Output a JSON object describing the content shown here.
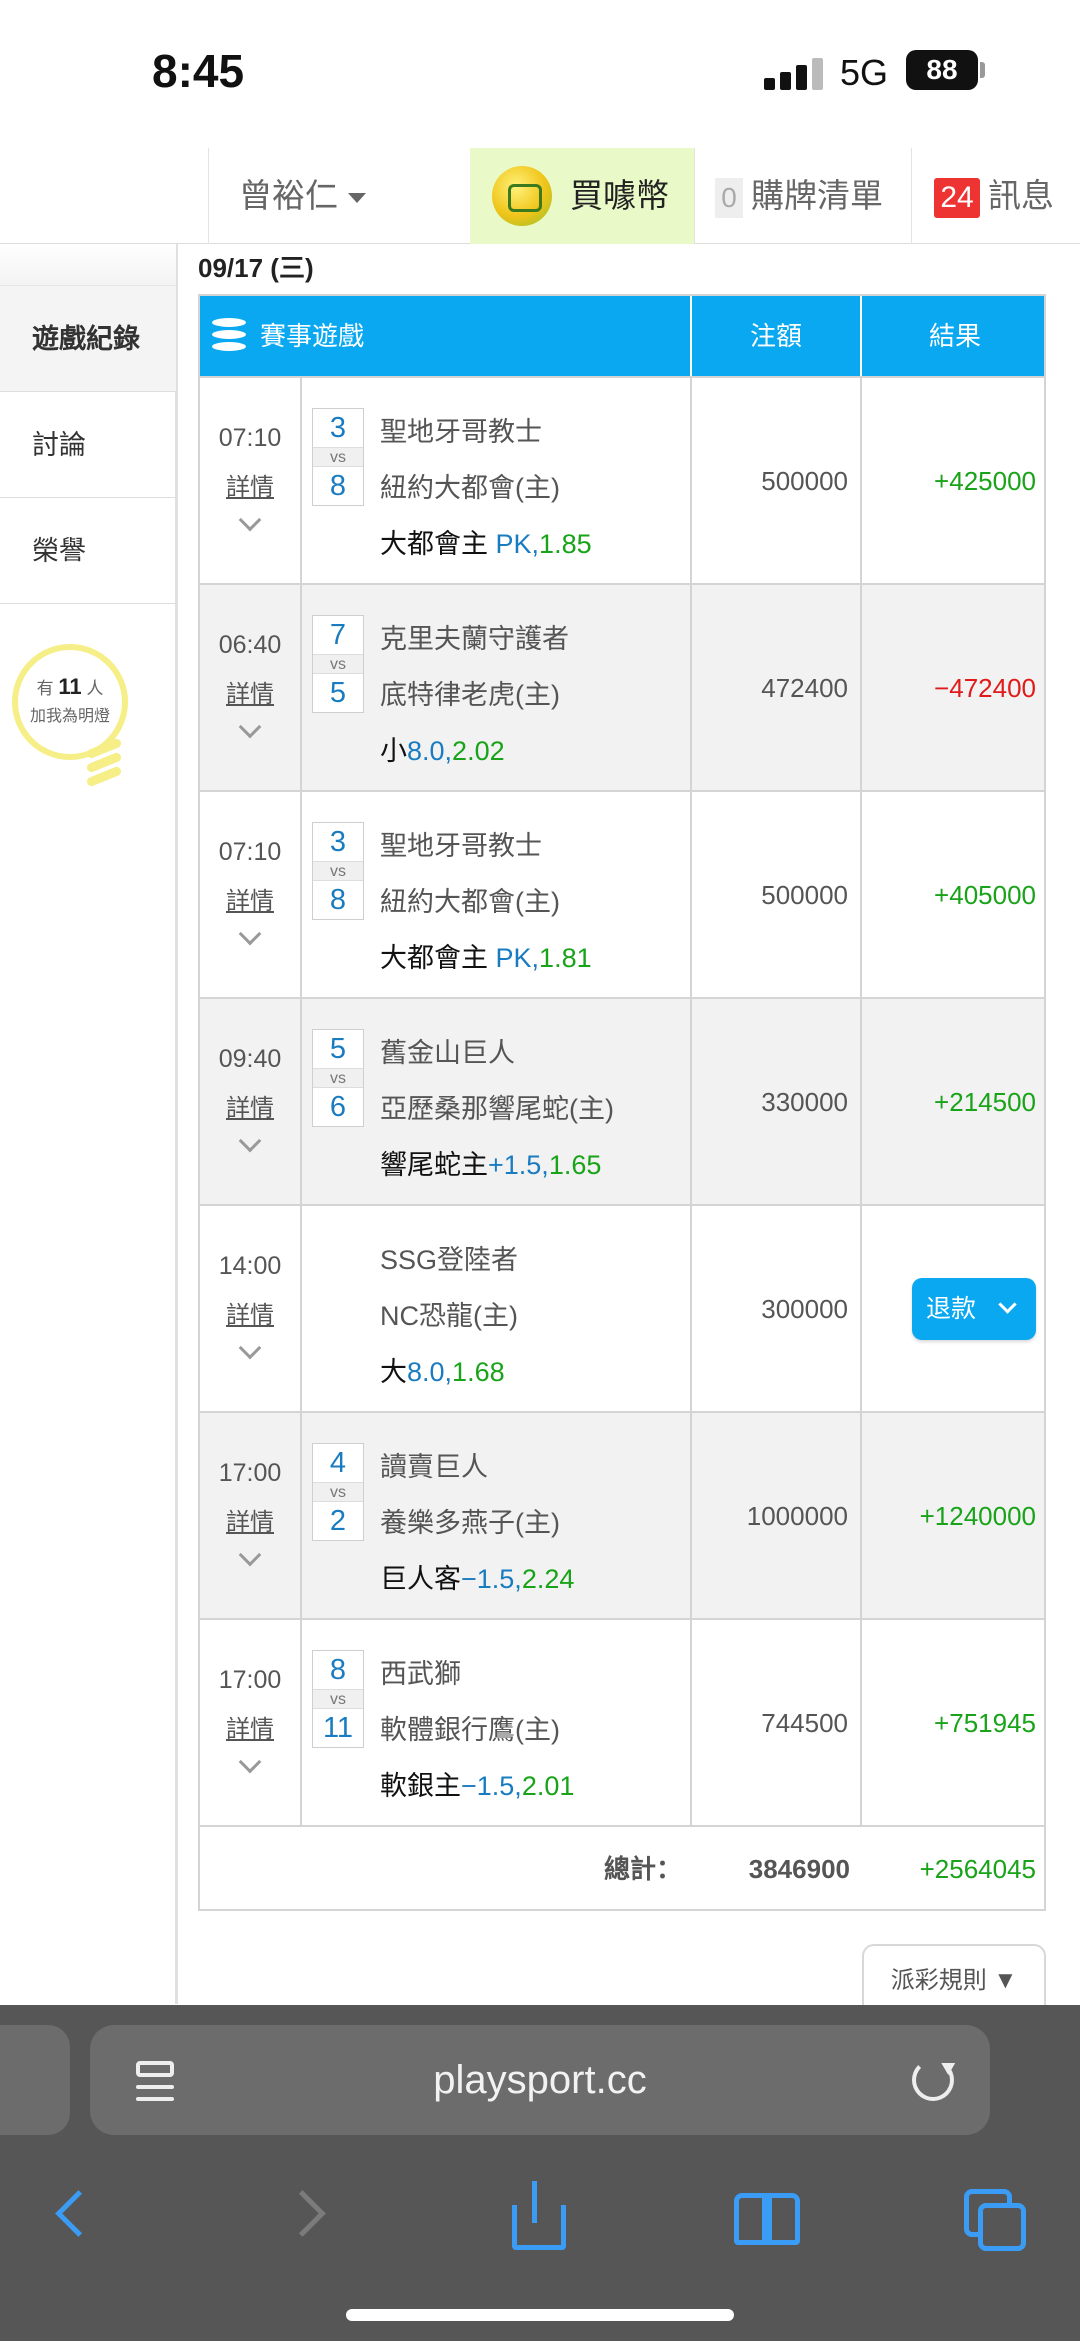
{
  "status_bar": {
    "time": "8:45",
    "network": "5G",
    "battery": "88"
  },
  "topnav": {
    "user": "曾裕仁",
    "coin_label": "買噱幣",
    "cart_count": "0",
    "cart_label": "購牌清單",
    "msg_count": "24",
    "msg_label": "訊息"
  },
  "sidebar": {
    "items": [
      {
        "label": "遊戲紀錄",
        "active": true
      },
      {
        "label": "討論"
      },
      {
        "label": "榮譽"
      }
    ],
    "bulb": {
      "prefix": "有",
      "count": "11",
      "suffix": "人",
      "line2": "加我為明燈"
    }
  },
  "date": "09/17 (三)",
  "table": {
    "headers": {
      "game": "賽事遊戲",
      "amount": "注額",
      "result": "結果"
    },
    "detail_label": "詳情",
    "vs_label": "vs",
    "rows": [
      {
        "time": "07:10",
        "s1": "3",
        "s2": "8",
        "team1": "聖地牙哥教士",
        "team2": "紐約大都會(主)",
        "pick_text": "大都會主 ",
        "pick_line": "PK,",
        "pick_odds": "1.85",
        "amount": "500000",
        "result": "+425000",
        "result_type": "pos"
      },
      {
        "time": "06:40",
        "s1": "7",
        "s2": "5",
        "team1": "克里夫蘭守護者",
        "team2": "底特律老虎(主)",
        "pick_text": "小",
        "pick_line": "8.0,",
        "pick_odds": "2.02",
        "amount": "472400",
        "result": "−472400",
        "result_type": "neg"
      },
      {
        "time": "07:10",
        "s1": "3",
        "s2": "8",
        "team1": "聖地牙哥教士",
        "team2": "紐約大都會(主)",
        "pick_text": "大都會主 ",
        "pick_line": "PK,",
        "pick_odds": "1.81",
        "amount": "500000",
        "result": "+405000",
        "result_type": "pos"
      },
      {
        "time": "09:40",
        "s1": "5",
        "s2": "6",
        "team1": "舊金山巨人",
        "team2": "亞歷桑那響尾蛇(主)",
        "pick_text": "響尾蛇主",
        "pick_line": "+1.5,",
        "pick_odds": "1.65",
        "amount": "330000",
        "result": "+214500",
        "result_type": "pos"
      },
      {
        "time": "14:00",
        "s1": "",
        "s2": "",
        "team1": "SSG登陸者",
        "team2": "NC恐龍(主)",
        "pick_text": "大",
        "pick_line": "8.0,",
        "pick_odds": "1.68",
        "amount": "300000",
        "result": "退款",
        "result_type": "refund"
      },
      {
        "time": "17:00",
        "s1": "4",
        "s2": "2",
        "team1": "讀賣巨人",
        "team2": "養樂多燕子(主)",
        "pick_text": "巨人客",
        "pick_line": "−1.5,",
        "pick_odds": "2.24",
        "amount": "1000000",
        "result": "+1240000",
        "result_type": "pos"
      },
      {
        "time": "17:00",
        "s1": "8",
        "s2": "11",
        "team1": "西武獅",
        "team2": "軟體銀行鷹(主)",
        "pick_text": "軟銀主",
        "pick_line": "−1.5,",
        "pick_odds": "2.01",
        "amount": "744500",
        "result": "+751945",
        "result_type": "pos"
      }
    ],
    "total": {
      "label": "總計：",
      "amount": "3846900",
      "result": "+2564045"
    }
  },
  "rules_button": "派彩規則 ▼",
  "browser": {
    "url": "playsport.cc"
  },
  "colors": {
    "header_blue": "#0aa8f0",
    "win_green": "#19a319",
    "loss_red": "#e01b1b",
    "line_blue": "#1a7cc0",
    "coin_bg": "#e9f9c7"
  }
}
